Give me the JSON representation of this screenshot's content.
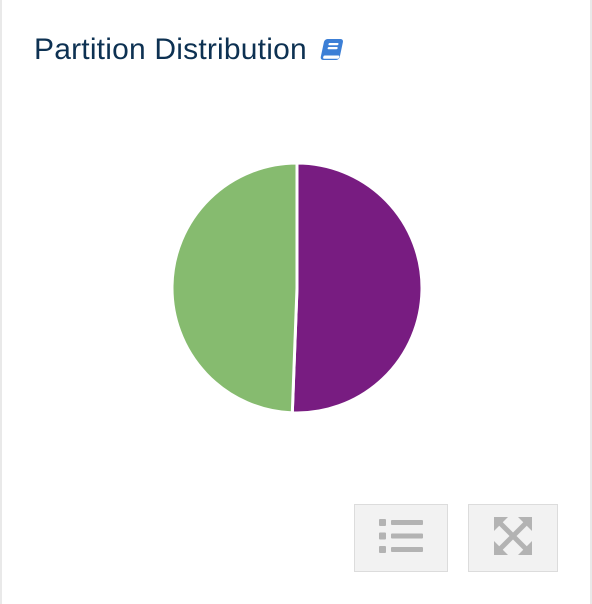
{
  "panel": {
    "title": "Partition Distribution",
    "info_icon": "book-icon"
  },
  "chart_data": {
    "type": "pie",
    "categories": [
      "",
      ""
    ],
    "values": [
      50.6,
      49.4
    ],
    "colors": [
      "#781c81",
      "#86bb6f"
    ],
    "start_angle_deg": 0,
    "direction": "clockwise",
    "separator_color": "#ffffff",
    "legend": "none"
  },
  "controls": {
    "legend_icon": "list-icon",
    "expand_icon": "expand-icon"
  },
  "colors": {
    "title": "#0d3152",
    "accent_icon": "#3c7fd6",
    "control_bg": "#f2f2f2",
    "control_icon": "#b3b3b3"
  }
}
